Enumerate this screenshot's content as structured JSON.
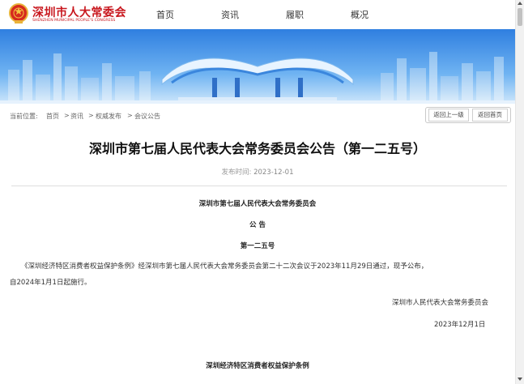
{
  "header": {
    "logo_title": "深圳市人大常委会",
    "logo_subtitle": "SHENZHEN MUNICIPAL PEOPLE'S CONGRESS",
    "nav": [
      "首页",
      "资讯",
      "履职",
      "概况"
    ]
  },
  "breadcrumb": {
    "label": "当前位置:",
    "items": [
      "首页",
      "资讯",
      "权威发布",
      "会议公告"
    ],
    "separator": ">"
  },
  "actions": {
    "back_label": "返回上一级",
    "home_label": "返回首页"
  },
  "article": {
    "title": "深圳市第七届人民代表大会常务委员会公告（第一二五号）",
    "pub_label": "发布时间:",
    "pub_date": "2023-12-01",
    "org": "深圳市第七届人民代表大会常务委员会",
    "notice_word": "公 告",
    "number": "第一二五号",
    "body_line1": "《深圳经济特区消费者权益保护条例》经深圳市第七届人民代表大会常务委员会第二十二次会议于2023年11月29日通过，现予公布，",
    "body_line2": "自2024年1月1日起施行。",
    "signature": "深圳市人民代表大会常务委员会",
    "sign_date": "2023年12月1日",
    "next_title": "深圳经济特区消费者权益保护条例"
  },
  "colors": {
    "brand_red": "#c8161d",
    "banner_blue": "#3d8ee8"
  }
}
